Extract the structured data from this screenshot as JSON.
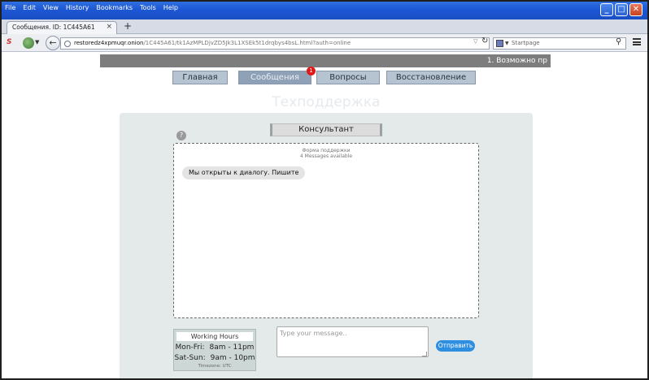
{
  "browser": {
    "menu": [
      "File",
      "Edit",
      "View",
      "History",
      "Bookmarks",
      "Tools",
      "Help"
    ],
    "tab_title": "Сообщения. ID: 1C445A61",
    "new_tab": "+",
    "close_tab": "×",
    "url_host": "restoredz4xpmuqr.onion",
    "url_path": "/1C445A61/tk1AzMPLDjvZD5Jk3L1XSEk5t1drqbys4bsL.html?auth=online",
    "search_placeholder": "Startpage",
    "window_buttons": [
      "_",
      "□",
      "✕"
    ]
  },
  "page": {
    "ticker_text": "1. Возможно пр",
    "nav": [
      {
        "label": "Главная"
      },
      {
        "label": "Сообщения",
        "badge": "1"
      },
      {
        "label": "Вопросы"
      },
      {
        "label": "Восстановление"
      }
    ],
    "heading": "Техподдержка",
    "consultant_label": "Консультант",
    "help_symbol": "?",
    "chat": {
      "form_title": "Форма поддержки",
      "messages_available": "4 Messages available",
      "message": "Мы открыты к диалогу. Пишите"
    },
    "hours": {
      "title": "Working Hours",
      "weekday_label": "Mon-Fri:",
      "weekday_hours": "8am - 11pm",
      "weekend_label": "Sat-Sun:",
      "weekend_hours": "9am - 10pm",
      "timezone": "Timezone: UTC"
    },
    "input_placeholder": "Type your message..",
    "send_label": "Отправить"
  },
  "colors": {
    "titlebar": "#1d57d4",
    "ticker": "#7d7d7d",
    "nav_button": "#b6c3d1",
    "nav_active": "#8ea1b6",
    "badge": "#e01818",
    "panel": "#e4e9e9",
    "send_button": "#2e8ee0"
  }
}
